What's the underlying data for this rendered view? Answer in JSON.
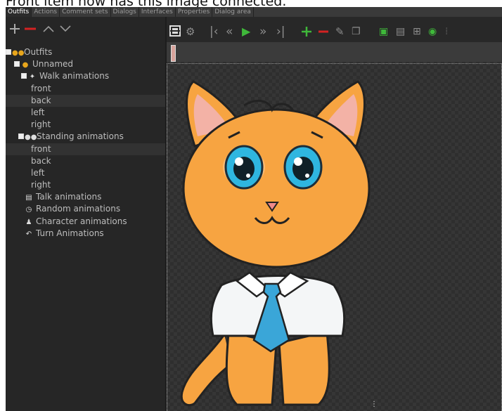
{
  "caption": "Front item now has this image connected.",
  "tabs": [
    "Outfits",
    "Actions",
    "Comment sets",
    "Dialogs",
    "Interfaces",
    "Properties",
    "Dialog area"
  ],
  "active_tab": "Outfits",
  "left_toolbar": {
    "add_icon": "plus-icon",
    "remove_icon": "minus-icon",
    "up_icon": "chevron-up-icon",
    "down_icon": "chevron-down-icon"
  },
  "tree": {
    "root": "Outfits",
    "character": "Unnamed",
    "walk": "Walk animations",
    "walk_dirs": [
      "front",
      "back",
      "left",
      "right"
    ],
    "standing": "Standing animations",
    "standing_dirs": [
      "front",
      "back",
      "left",
      "right"
    ],
    "talk": "Talk animations",
    "random": "Random animations",
    "character_anims": "Character animations",
    "turn": "Turn Animations"
  },
  "colors": {
    "accent_green": "#3fb83a",
    "accent_red": "#d32222",
    "folder_orange": "#e8a61c"
  }
}
